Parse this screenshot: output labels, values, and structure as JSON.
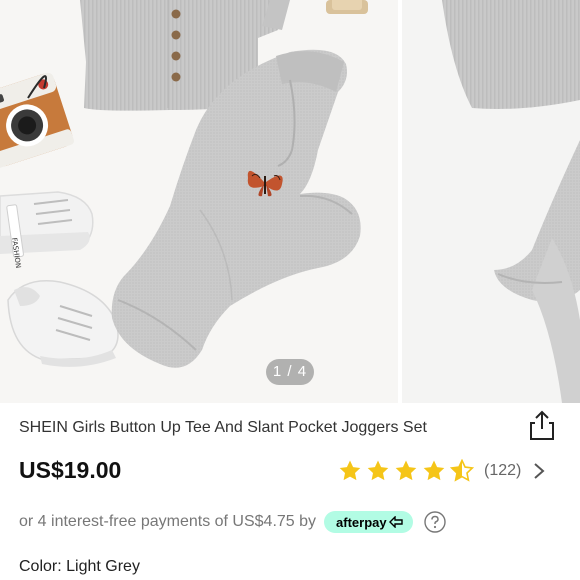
{
  "carousel": {
    "indicator": "1 / 4",
    "slide_1": {
      "tag_text": "FASHION"
    }
  },
  "product": {
    "title": "SHEIN Girls Button Up Tee And Slant Pocket Joggers Set",
    "price": "US$19.00",
    "rating": {
      "stars": 4.5,
      "count": "(122)"
    },
    "installments": {
      "text": "or 4 interest-free payments of US$4.75 by",
      "provider": "afterpay"
    },
    "color_label": "Color: Light Grey"
  },
  "colors": {
    "star": "#f5c518",
    "afterpay": "#b2fce4",
    "garment": "#c8c8c8"
  },
  "icons": {
    "share": "share-icon",
    "chevron": "chevron-right-icon",
    "help": "help-circle-icon"
  }
}
